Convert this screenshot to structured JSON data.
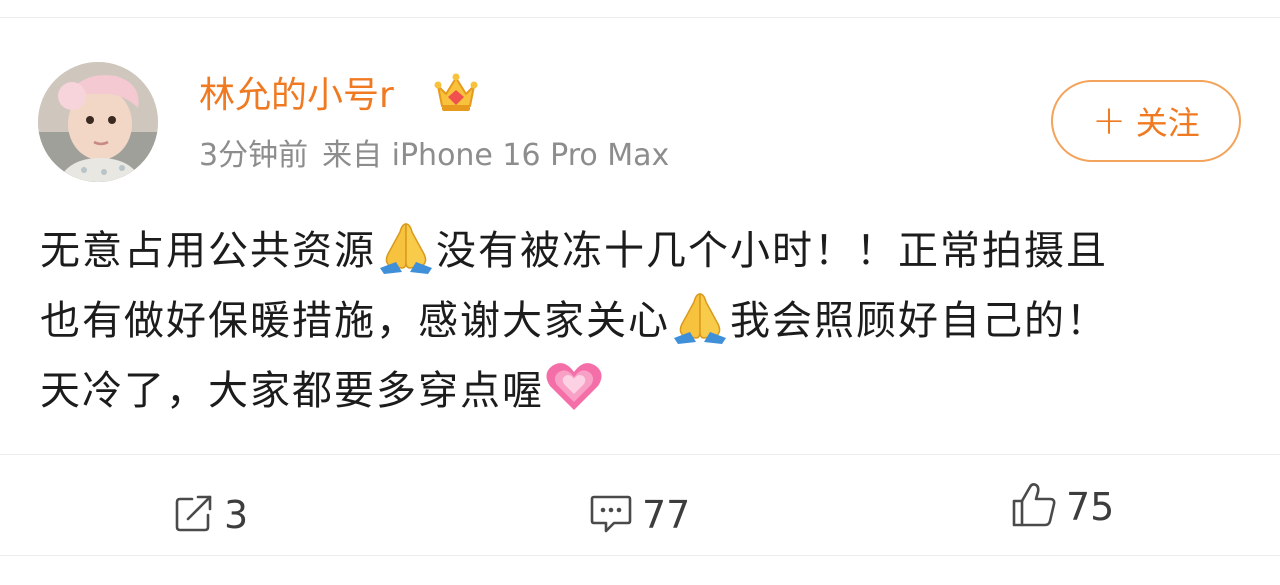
{
  "post": {
    "user": {
      "name": "林允的小号r",
      "badge_icon": "crown-vip-icon",
      "avatar_icon": "baby-avatar-photo"
    },
    "meta": {
      "time": "3分钟前",
      "source": "来自 iPhone 16 Pro Max"
    },
    "follow_button": {
      "icon": "+",
      "label": "关注"
    },
    "content": {
      "line1_a": "无意占用公共资源",
      "line1_b": "没有被冻十几个小时！！正常拍摄且",
      "line2_a": "也有做好保暖措施，感谢大家关心",
      "line2_b": "我会照顾好自己的！",
      "line3_a": "天冷了，大家都要多穿点喔"
    },
    "actions": {
      "repost_count": "3",
      "comment_count": "77",
      "like_count": "75"
    }
  },
  "colors": {
    "username": "#f07a22",
    "meta": "#8d8d8d",
    "follow_border": "#f3a35c",
    "text": "#1c1c1c",
    "divider": "#ededed"
  }
}
